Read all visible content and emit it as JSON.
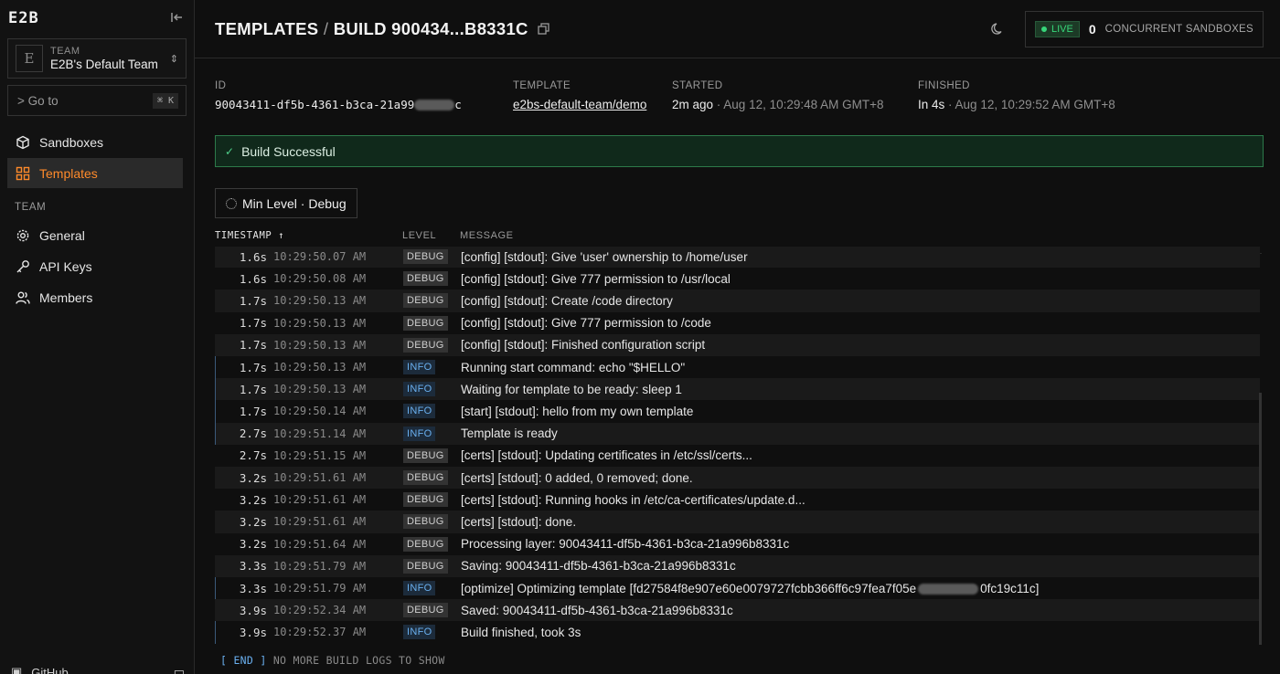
{
  "sidebar": {
    "logo": "E2B",
    "team_caption": "TEAM",
    "team_name": "E2B's Default Team",
    "team_avatar": "E",
    "goto_label": "> Go to",
    "goto_shortcut": "⌘ K",
    "items": [
      {
        "label": "Sandboxes",
        "icon": "cube-icon"
      },
      {
        "label": "Templates",
        "icon": "grid-icon",
        "active": true
      }
    ],
    "section_label": "TEAM",
    "team_items": [
      {
        "label": "General",
        "icon": "gear-icon"
      },
      {
        "label": "API Keys",
        "icon": "key-icon"
      },
      {
        "label": "Members",
        "icon": "users-icon"
      }
    ],
    "bottom_label": "GitHub"
  },
  "header": {
    "title_prefix": "TEMPLATES",
    "title_sep": "/",
    "title_build": "BUILD 900434...B8331C",
    "live_label": "LIVE",
    "concurrent_count": "0",
    "concurrent_label": "CONCURRENT SANDBOXES"
  },
  "meta": {
    "id_label": "ID",
    "id_value_start": "90043411-df5b-4361-b3ca-21a99",
    "id_value_end": "c",
    "template_label": "TEMPLATE",
    "template_value": "e2bs-default-team/demo",
    "started_label": "STARTED",
    "started_rel": "2m ago",
    "started_abs": "· Aug 12, 10:29:48 AM GMT+8",
    "finished_label": "FINISHED",
    "finished_rel": "In 4s",
    "finished_abs": "· Aug 12, 10:29:52 AM GMT+8"
  },
  "status": {
    "text": "Build Successful",
    "color": "#2d7a4a"
  },
  "filter": {
    "label": "Min Level · Debug"
  },
  "log_table": {
    "columns": {
      "timestamp": "TIMESTAMP ↑",
      "level": "LEVEL",
      "message": "MESSAGE"
    },
    "rows": [
      {
        "dur": "1.6s",
        "time": "10:29:50.07 AM",
        "level": "DEBUG",
        "msg": "[config] [stdout]: Give 'user' ownership to /home/user"
      },
      {
        "dur": "1.6s",
        "time": "10:29:50.08 AM",
        "level": "DEBUG",
        "msg": "[config] [stdout]: Give 777 permission to /usr/local"
      },
      {
        "dur": "1.7s",
        "time": "10:29:50.13 AM",
        "level": "DEBUG",
        "msg": "[config] [stdout]: Create /code directory"
      },
      {
        "dur": "1.7s",
        "time": "10:29:50.13 AM",
        "level": "DEBUG",
        "msg": "[config] [stdout]: Give 777 permission to /code"
      },
      {
        "dur": "1.7s",
        "time": "10:29:50.13 AM",
        "level": "DEBUG",
        "msg": "[config] [stdout]: Finished configuration script"
      },
      {
        "dur": "1.7s",
        "time": "10:29:50.13 AM",
        "level": "INFO",
        "msg": "Running start command: echo \"$HELLO\""
      },
      {
        "dur": "1.7s",
        "time": "10:29:50.13 AM",
        "level": "INFO",
        "msg": "Waiting for template to be ready: sleep 1"
      },
      {
        "dur": "1.7s",
        "time": "10:29:50.14 AM",
        "level": "INFO",
        "msg": "[start] [stdout]: hello from my own template"
      },
      {
        "dur": "2.7s",
        "time": "10:29:51.14 AM",
        "level": "INFO",
        "msg": "Template is ready"
      },
      {
        "dur": "2.7s",
        "time": "10:29:51.15 AM",
        "level": "DEBUG",
        "msg": "[certs] [stdout]: Updating certificates in /etc/ssl/certs..."
      },
      {
        "dur": "3.2s",
        "time": "10:29:51.61 AM",
        "level": "DEBUG",
        "msg": "[certs] [stdout]: 0 added, 0 removed; done."
      },
      {
        "dur": "3.2s",
        "time": "10:29:51.61 AM",
        "level": "DEBUG",
        "msg": "[certs] [stdout]: Running hooks in /etc/ca-certificates/update.d..."
      },
      {
        "dur": "3.2s",
        "time": "10:29:51.61 AM",
        "level": "DEBUG",
        "msg": "[certs] [stdout]: done."
      },
      {
        "dur": "3.2s",
        "time": "10:29:51.64 AM",
        "level": "DEBUG",
        "msg": "Processing layer: 90043411-df5b-4361-b3ca-21a996b8331c"
      },
      {
        "dur": "3.3s",
        "time": "10:29:51.79 AM",
        "level": "DEBUG",
        "msg": "Saving: 90043411-df5b-4361-b3ca-21a996b8331c"
      },
      {
        "dur": "3.3s",
        "time": "10:29:51.79 AM",
        "level": "INFO",
        "msg": "[optimize] Optimizing template [fd27584f8e907e60e0079727fcbb366ff6c97fea7f05e",
        "msg_end": "0fc19c11c]"
      },
      {
        "dur": "3.9s",
        "time": "10:29:52.34 AM",
        "level": "DEBUG",
        "msg": "Saved: 90043411-df5b-4361-b3ca-21a996b8331c"
      },
      {
        "dur": "3.9s",
        "time": "10:29:52.37 AM",
        "level": "INFO",
        "msg": "Build finished, took 3s"
      }
    ],
    "end_tag": "[ END ]",
    "end_text": "NO MORE BUILD LOGS TO SHOW"
  },
  "colors": {
    "accent": "#ff8a2a",
    "live": "#37d67a",
    "info": "#6ab0f0",
    "success_bg": "#10291b"
  }
}
